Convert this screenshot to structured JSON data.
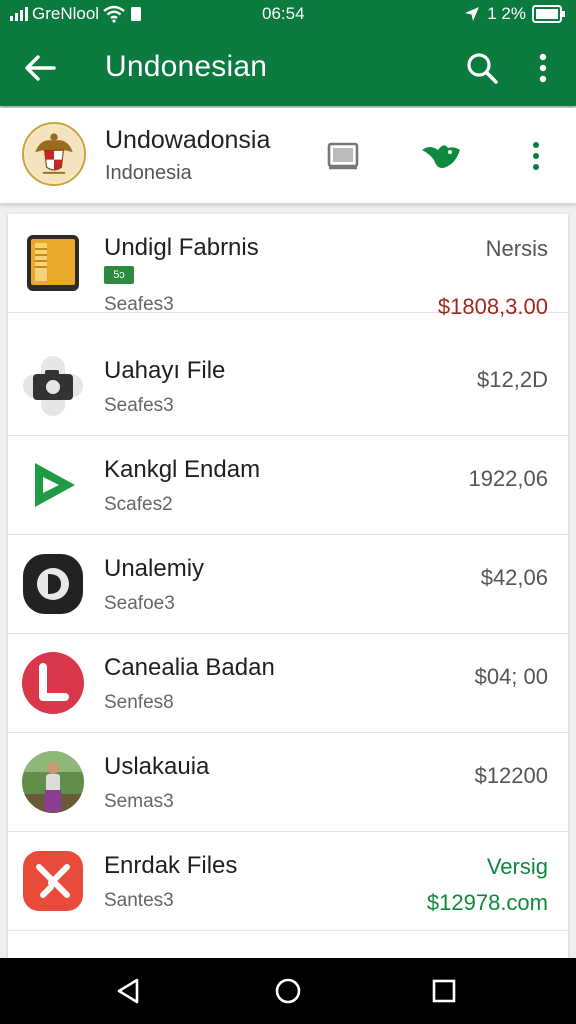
{
  "status_bar": {
    "carrier": "GreNlool",
    "time": "06:54",
    "battery": "1 2%"
  },
  "app_bar": {
    "title": "Undonesian"
  },
  "header": {
    "name": "Undowadonsia",
    "subtitle": "Indonesia"
  },
  "items": [
    {
      "name": "Undigl Fabrnis",
      "badge": "5ɔ",
      "sub": "Seafes3",
      "top_label": "Nersis",
      "price": "$1808,3.00",
      "icon": "tablet-icon",
      "price_color": "#a0291f"
    },
    {
      "name": "Uahayı File",
      "sub": "Seafes3",
      "price": "$12,2D",
      "icon": "camera-icon"
    },
    {
      "name": "Kankgl Endam",
      "sub": "Scafes2",
      "price": "1922,06",
      "icon": "play-icon"
    },
    {
      "name": "Unalemiy",
      "sub": "Seafoe3",
      "price": "$42,06",
      "icon": "app-d-icon"
    },
    {
      "name": "Canealia Badan",
      "sub": "Senfes8",
      "price": "$04; 00",
      "icon": "app-l-icon"
    },
    {
      "name": "Uslakauia",
      "sub": "Semas3",
      "price": "$12200",
      "icon": "person-photo-icon"
    },
    {
      "name": "Enrdak Files",
      "sub": "Santes3",
      "top_label": "Versig",
      "price": "$12978.com",
      "icon": "app-k-icon",
      "price_color": "#0e8a3e"
    }
  ],
  "colors": {
    "primary": "#0b7a3e",
    "accent_green": "#0e8a3e",
    "price_red": "#a0291f"
  }
}
